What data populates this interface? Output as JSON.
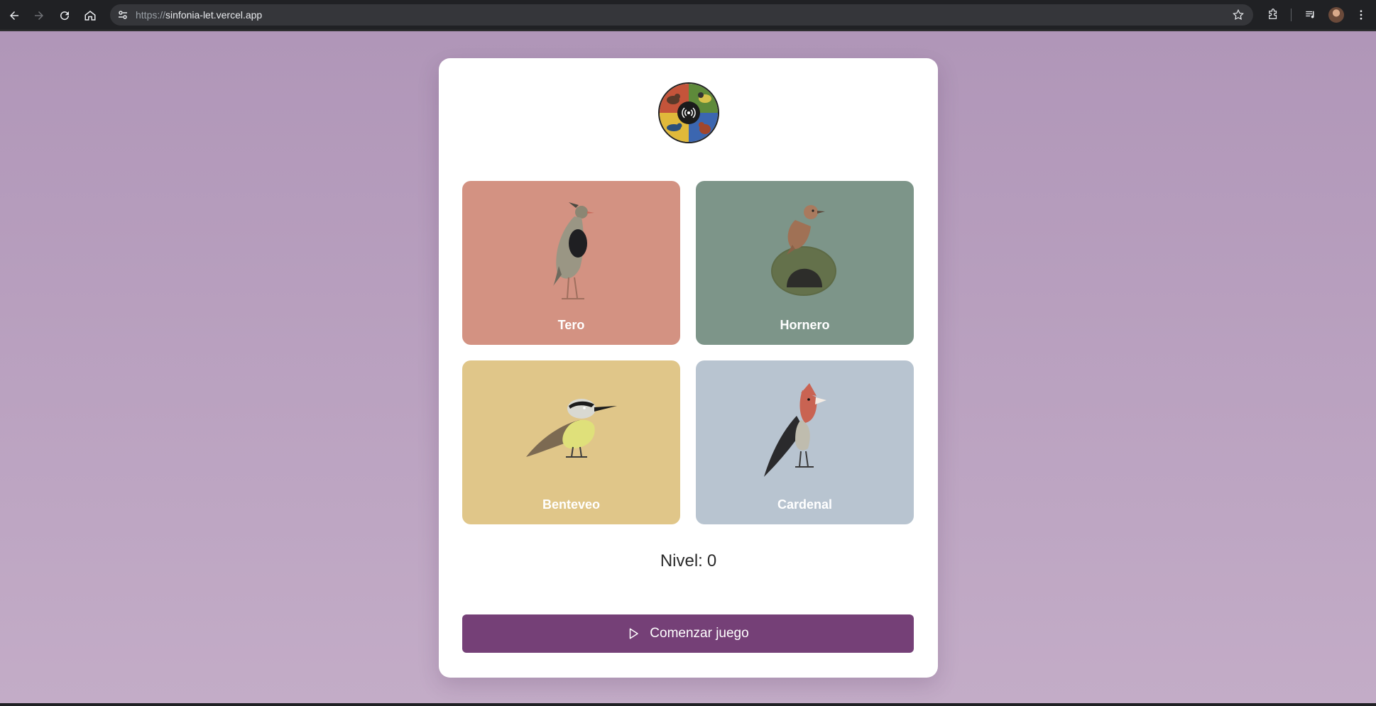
{
  "browser": {
    "url_scheme": "https://",
    "url_host": "sinfonia-let.vercel.app"
  },
  "birds": [
    {
      "name": "Tero",
      "color": "#d39282"
    },
    {
      "name": "Hornero",
      "color": "#7d9589"
    },
    {
      "name": "Benteveo",
      "color": "#e0c689"
    },
    {
      "name": "Cardenal",
      "color": "#b8c4d0"
    }
  ],
  "level": {
    "label": "Nivel:",
    "value": "0"
  },
  "start_button": {
    "label": "Comenzar juego",
    "icon": "play-icon",
    "color": "#754077"
  },
  "colors": {
    "background_top": "#b096b8",
    "background_bottom": "#c3acc7",
    "panel": "#ffffff"
  }
}
